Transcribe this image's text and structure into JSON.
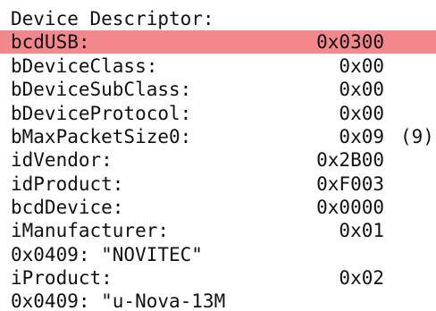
{
  "title": "Device Descriptor:",
  "highlight_color": "#f2888c",
  "fields": [
    {
      "label": "bcdUSB:",
      "value": "0x0300"
    },
    {
      "label": "bDeviceClass:",
      "value": "0x00"
    },
    {
      "label": "bDeviceSubClass:",
      "value": "0x00"
    },
    {
      "label": "bDeviceProtocol:",
      "value": "0x00"
    },
    {
      "label": "bMaxPacketSize0:",
      "value": "0x09",
      "decimal": "(9)"
    },
    {
      "label": "idVendor:",
      "value": "0x2B00"
    },
    {
      "label": "idProduct:",
      "value": "0xF003"
    },
    {
      "label": "bcdDevice:",
      "value": "0x0000"
    },
    {
      "label": "iManufacturer:",
      "value": "0x01"
    },
    {
      "label": "iProduct:",
      "value": "0x02"
    }
  ],
  "strings": {
    "manufacturer": "0x0409: \"NOVITEC\"",
    "product": "0x0409: \"u-Nova-13M"
  }
}
